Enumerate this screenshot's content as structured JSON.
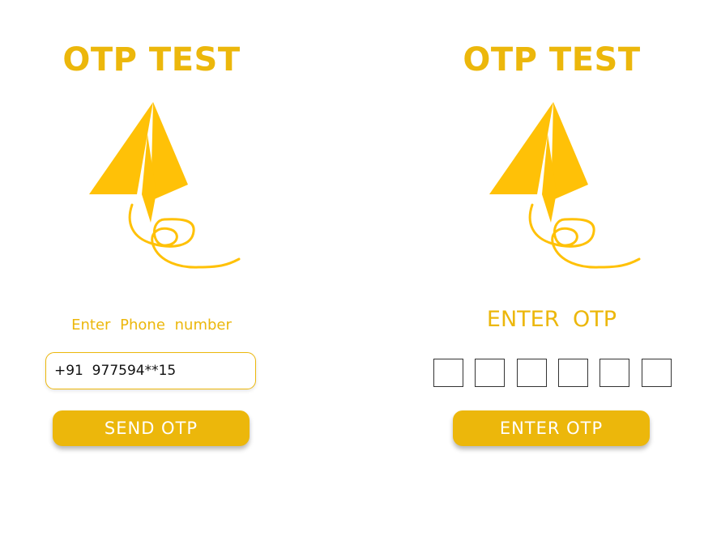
{
  "login_screen": {
    "title": "OTP TEST",
    "phone_label": "Enter  Phone  number",
    "phone_value": "+91  977594**15",
    "send_button_label": "SEND OTP"
  },
  "verify_screen": {
    "title": "OTP TEST",
    "otp_label": "ENTER  OTP",
    "otp_digits": [
      "",
      "",
      "",
      "",
      "",
      ""
    ],
    "enter_button_label": "ENTER OTP"
  },
  "icons": {
    "logo": "paper-plane-icon"
  },
  "colors": {
    "accent": "#ecb70b",
    "plane_fill": "#ffc107",
    "background": "#ffffff",
    "button_text": "#ffffff"
  }
}
